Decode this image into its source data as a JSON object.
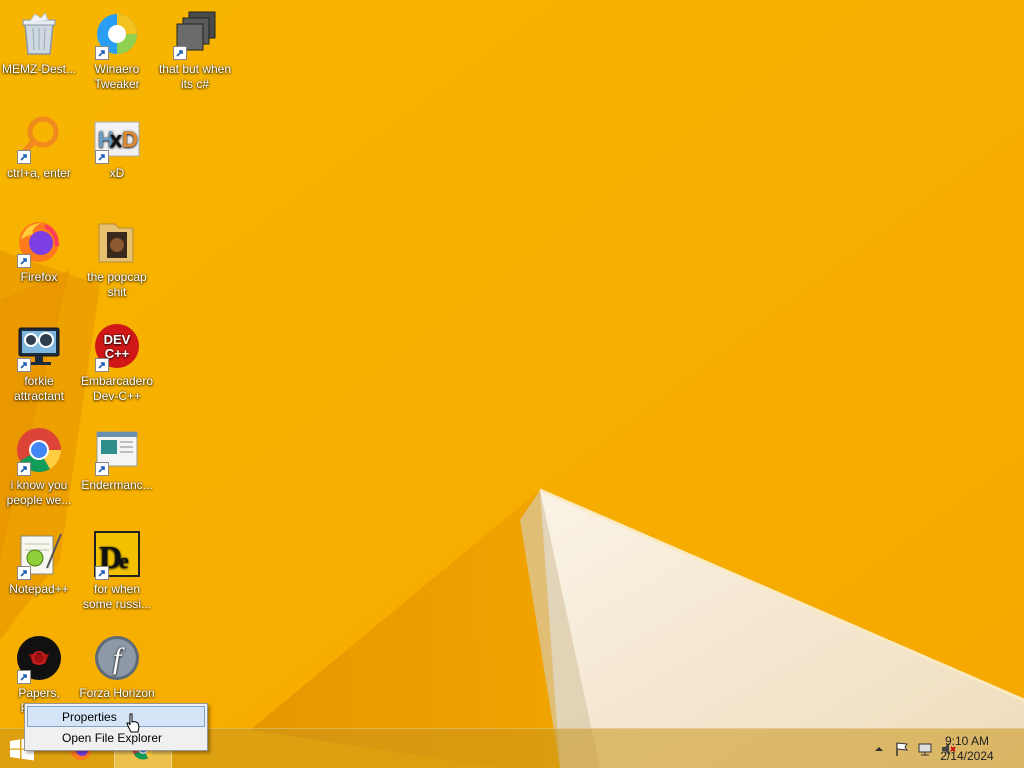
{
  "desktop": {
    "icons": [
      {
        "label": "MEMZ-Dest...",
        "icon": "recycle-bin-icon"
      },
      {
        "label": "Winaero Tweaker",
        "icon": "winaero-tweaker-icon"
      },
      {
        "label": "that but when its c#",
        "icon": "stacked-windows-icon"
      },
      {
        "label": "ctrl+a, enter",
        "icon": "magnifier-ring-icon"
      },
      {
        "label": "xD",
        "icon": "hxd-icon"
      },
      {
        "label": "Firefox",
        "icon": "firefox-icon"
      },
      {
        "label": "the popcap shit",
        "icon": "folder-icon"
      },
      {
        "label": "forkie attractant",
        "icon": "monitor-gear-icon"
      },
      {
        "label": "Embarcadero Dev-C++",
        "icon": "dev-cpp-icon"
      },
      {
        "label": "i know you people we...",
        "icon": "chrome-icon"
      },
      {
        "label": "Endermanc...",
        "icon": "window-app-icon"
      },
      {
        "label": "Notepad++",
        "icon": "notepad-plus-plus-icon"
      },
      {
        "label": "for when some russi...",
        "icon": "de-app-icon"
      },
      {
        "label": "Papers, Please",
        "icon": "papers-please-icon"
      },
      {
        "label": "Forza Horizon",
        "icon": "flash-icon"
      }
    ]
  },
  "context_menu": {
    "items": [
      {
        "label": "Properties",
        "hovered": true
      },
      {
        "label": "Open File Explorer",
        "hovered": false
      }
    ]
  },
  "taskbar": {
    "pinned": [
      "firefox-icon",
      "chrome-icon"
    ],
    "tray": {
      "icons": [
        "show-hidden-icons-chevron",
        "action-center-flag-icon",
        "network-icon",
        "volume-muted-icon"
      ],
      "time": "9:10 AM",
      "date": "2/14/2024"
    }
  },
  "colors": {
    "wallpaper_orange": "#f6b400",
    "wallpaper_light": "#f7e8c8",
    "taskbar": "#c8961e",
    "menu_bg": "#f0f0f0",
    "menu_hover": "#d5e4f7"
  }
}
